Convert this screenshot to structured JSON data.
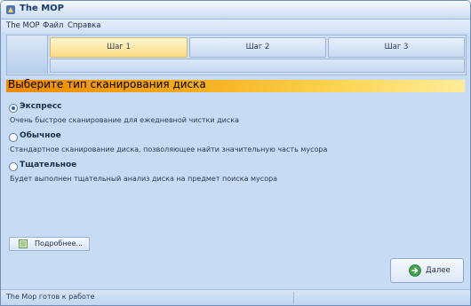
{
  "window": {
    "title": "The MOP"
  },
  "menu": {
    "items": [
      "The MOP",
      "Файл",
      "Справка"
    ]
  },
  "steps": [
    {
      "label": "Шаг 1",
      "active": true
    },
    {
      "label": "Шаг 2",
      "active": false
    },
    {
      "label": "Шаг 3",
      "active": false
    }
  ],
  "heading": "Выберите тип сканирования диска",
  "options": [
    {
      "title": "Экспресс",
      "description": "Очень быстрое сканирование для ежедневной чистки диска",
      "selected": true
    },
    {
      "title": "Обычное",
      "description": "Стандартное сканирование диска, позволяющее найти значительную часть мусора",
      "selected": false
    },
    {
      "title": "Тщательное",
      "description": "Будет выполнен тщательный анализ диска на предмет поиска мусора",
      "selected": false
    }
  ],
  "buttons": {
    "details": "Подробнее...",
    "next": "Далее"
  },
  "status": {
    "text": "The Mop готов к работе"
  },
  "icons": {
    "app": "app-icon",
    "details": "list-icon",
    "next": "arrow-right-circle-icon"
  },
  "colors": {
    "accent_orange": "#f08a00",
    "window_bg": "#c7dbf4",
    "next_green": "#3ea24a"
  }
}
